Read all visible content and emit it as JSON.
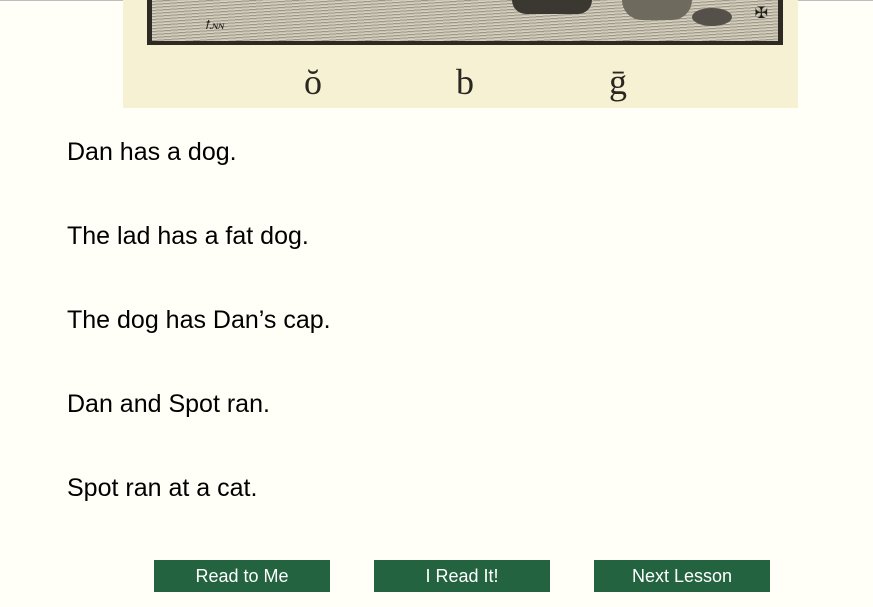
{
  "illustration": {
    "icon": "engraving-illustration",
    "phonograms": [
      "ŏ",
      "b",
      "ḡ"
    ]
  },
  "sentences": [
    "Dan has a dog.",
    "The lad has a fat dog.",
    "The dog has Dan’s cap.",
    "Dan and Spot ran.",
    "Spot ran at a cat."
  ],
  "buttons": {
    "read_to_me": "Read to Me",
    "i_read_it": "I Read It!",
    "next_lesson": "Next Lesson"
  },
  "colors": {
    "page_background": "#fffff7",
    "button_background": "#236340",
    "button_text": "#ffffff",
    "plate_background": "#f7f1d3"
  }
}
